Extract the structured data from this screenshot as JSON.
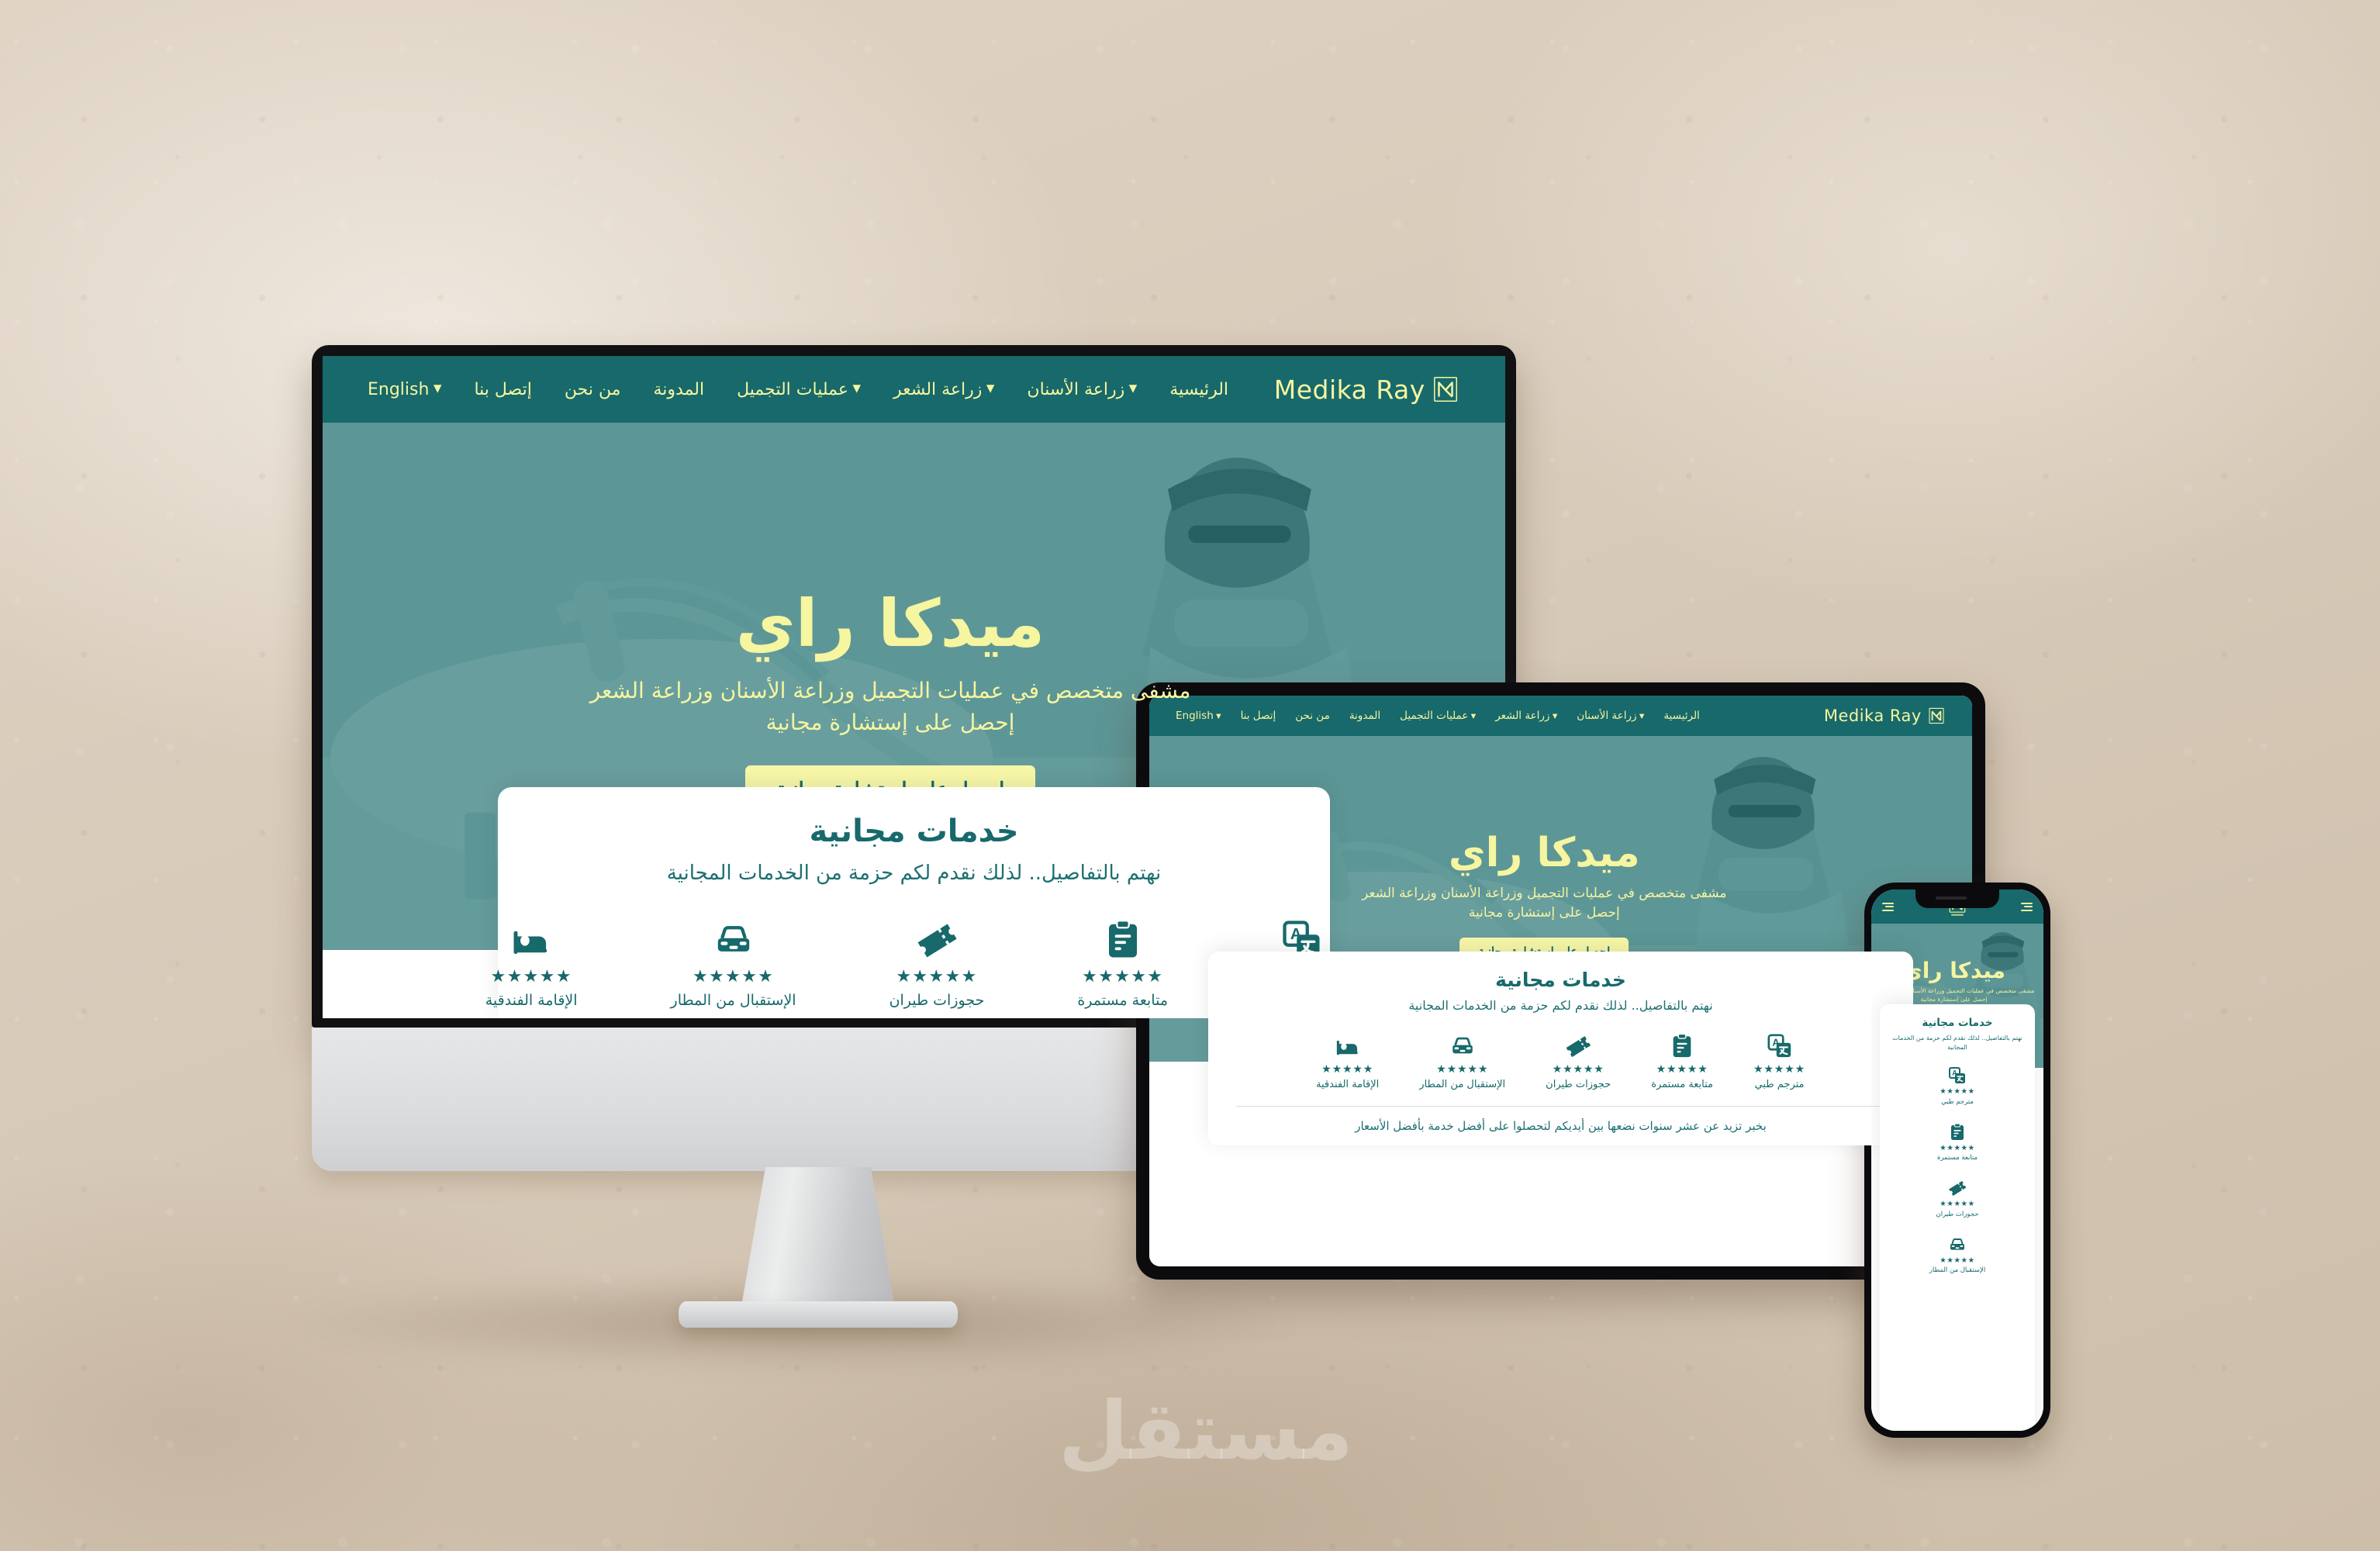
{
  "mockup": {
    "background_color": "#d9ccbc",
    "watermark_text": "مستقل"
  },
  "brand": {
    "name": "Medika Ray",
    "logo_icon": "medika-ray-monogram-icon",
    "teal": "#17696b",
    "cream": "#f6f5a0"
  },
  "nav": {
    "items": [
      {
        "label": "الرئيسية",
        "active": true,
        "has_caret": false
      },
      {
        "label": "زراعة الأسنان",
        "active": false,
        "has_caret": true
      },
      {
        "label": "زراعة الشعر",
        "active": false,
        "has_caret": true
      },
      {
        "label": "عمليات التجميل",
        "active": false,
        "has_caret": true
      },
      {
        "label": "المدونة",
        "active": false,
        "has_caret": false
      },
      {
        "label": "من نحن",
        "active": false,
        "has_caret": false
      },
      {
        "label": "إتصل بنا",
        "active": false,
        "has_caret": false
      },
      {
        "label": "English",
        "active": false,
        "has_caret": true
      }
    ]
  },
  "hero": {
    "title": "ميدكا راي",
    "subtitle_line1": "مشفى متخصص في عمليات التجميل وزراعة الأسنان وزراعة الشعر",
    "subtitle_line2": "إحصل على إستشارة مجانية",
    "cta_label": "احصل على إستشارة مجانية",
    "background_image": "dentist-clinic-photo"
  },
  "services": {
    "title": "خدمات مجانية",
    "subtitle": "نهتم بالتفاصيل.. لذلك نقدم لكم حزمة من الخدمات المجانية",
    "stars": "★★★★★",
    "note": "بخبر تزيد عن عشر سنوات نضعها بين أيديكم لتحصلوا على أفضل خدمة بأفضل الأسعار",
    "items": [
      {
        "label": "مترجم طبي",
        "icon": "translate-icon"
      },
      {
        "label": "متابعة مستمرة",
        "icon": "clipboard-icon"
      },
      {
        "label": "حجوزات طيران",
        "icon": "ticket-icon"
      },
      {
        "label": "الإستقبال من المطار",
        "icon": "car-icon"
      },
      {
        "label": "الإقامة الفندقية",
        "icon": "hotel-bed-icon"
      }
    ]
  },
  "phone": {
    "menu_icon": "hamburger-menu-icon"
  }
}
